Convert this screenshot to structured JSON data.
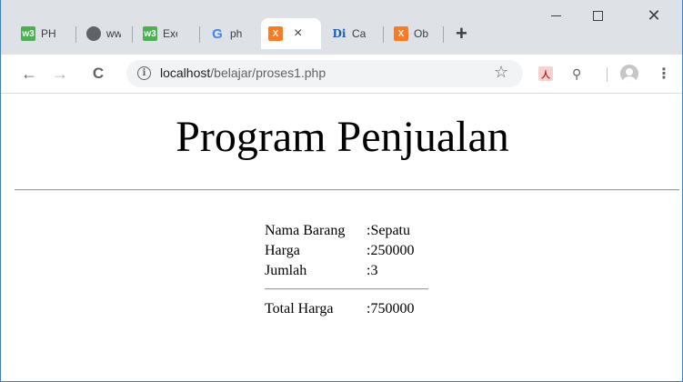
{
  "browser": {
    "tabs": [
      {
        "favicon": "w3schools-icon",
        "favicon_text": "w3",
        "favicon_color": "#4caf50",
        "title": "PH"
      },
      {
        "favicon": "globe-icon",
        "favicon_text": "",
        "favicon_color": "#5f6368",
        "title": "ww"
      },
      {
        "favicon": "w3schools-icon",
        "favicon_text": "w3",
        "favicon_color": "#4caf50",
        "title": "Exe"
      },
      {
        "favicon": "google-icon",
        "favicon_text": "G",
        "favicon_color": "#4285f4",
        "title": "ph"
      },
      {
        "favicon": "xampp-icon",
        "favicon_text": "X",
        "favicon_color": "#fb7a24",
        "title": "",
        "active": true
      },
      {
        "favicon": "dictionary-icon",
        "favicon_text": "Di",
        "favicon_color": "#1a5fb4",
        "title": "Ca"
      },
      {
        "favicon": "xampp-icon",
        "favicon_text": "X",
        "favicon_color": "#fb7a24",
        "title": "Ob"
      }
    ],
    "new_tab_label": "+",
    "close_tab_glyph": "×",
    "window_controls": {
      "close_glyph": "✕"
    },
    "nav": {
      "back": "←",
      "forward": "→",
      "reload": "C"
    },
    "url_host": "localhost",
    "url_path": "/belajar/proses1.php",
    "info_glyph": "i",
    "bookmark_star": "☆",
    "extensions": [
      {
        "icon": "pdf-extension-icon",
        "glyph": "人"
      },
      {
        "icon": "search-extension-icon",
        "glyph": "⚲"
      }
    ],
    "menu_glyph": "⋮"
  },
  "page": {
    "title": "Program Penjualan",
    "rows": [
      {
        "label": "Nama Barang",
        "value": ":Sepatu"
      },
      {
        "label": "Harga",
        "value": ":250000"
      },
      {
        "label": "Jumlah",
        "value": ":3"
      }
    ],
    "total_label": "Total Harga",
    "total_value": ":750000"
  }
}
